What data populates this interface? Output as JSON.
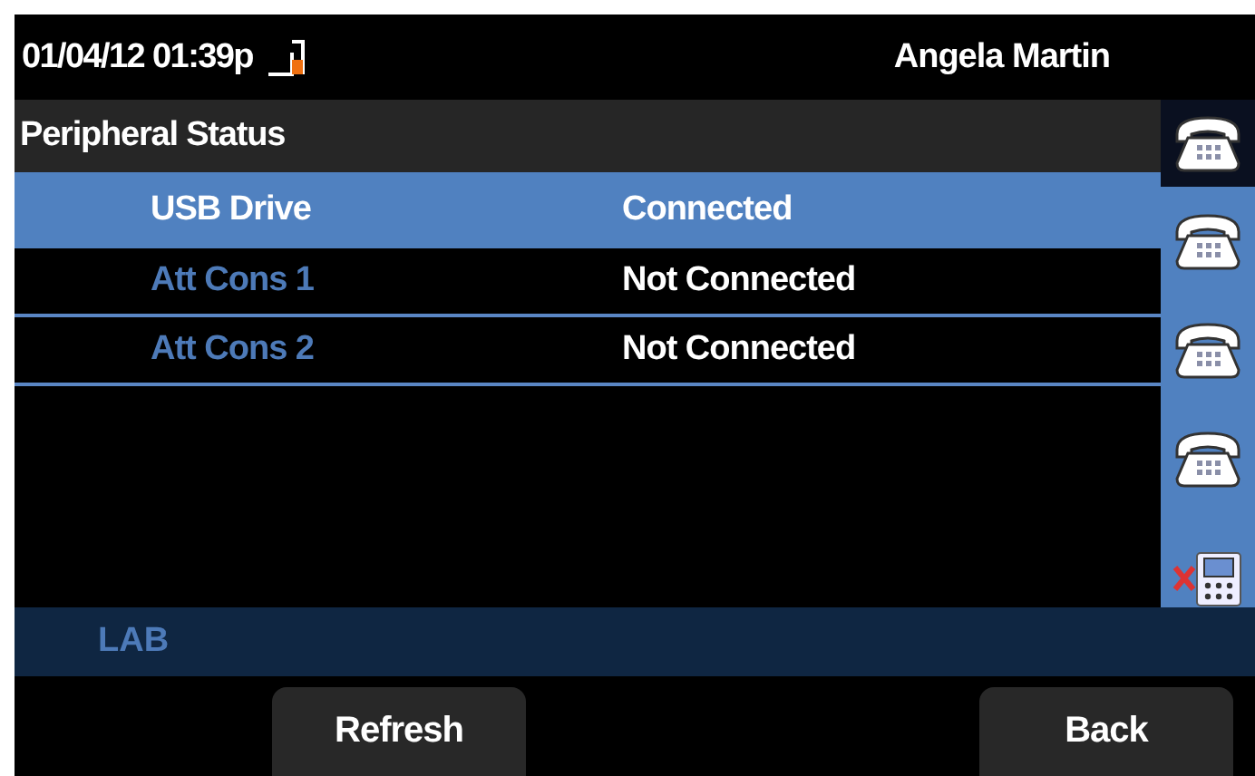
{
  "status_bar": {
    "datetime": "01/04/12 01:39p",
    "user": "Angela Martin"
  },
  "title": "Peripheral Status",
  "peripherals": [
    {
      "name": "USB Drive",
      "status": "Connected",
      "selected": true
    },
    {
      "name": "Att Cons 1",
      "status": "Not Connected",
      "selected": false
    },
    {
      "name": "Att Cons 2",
      "status": "Not Connected",
      "selected": false
    }
  ],
  "line_keys": [
    {
      "kind": "phone"
    },
    {
      "kind": "phone"
    },
    {
      "kind": "phone"
    },
    {
      "kind": "phone"
    },
    {
      "kind": "unavailable"
    }
  ],
  "line_label": "LAB",
  "softkeys": [
    {
      "label": "Refresh"
    },
    {
      "label": "Back"
    }
  ]
}
